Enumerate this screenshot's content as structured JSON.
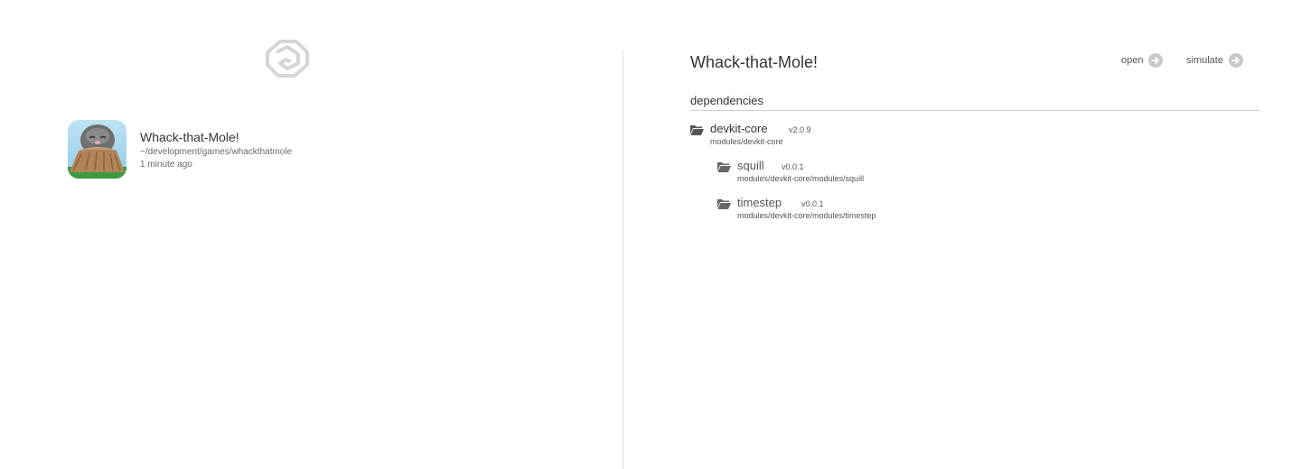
{
  "sidebar": {
    "logo_icon": "devkit-logo-icon",
    "projects": [
      {
        "name": "Whack-that-Mole!",
        "path": "~/development/games/whackthatmole",
        "modified": "1 minute ago",
        "icon": "mole-app-icon"
      }
    ]
  },
  "detail": {
    "title": "Whack-that-Mole!",
    "actions": {
      "open_label": "open",
      "simulate_label": "simulate",
      "icon": "arrow-right-circle-icon"
    },
    "dependencies_label": "dependencies",
    "dependencies": [
      {
        "name": "devkit-core",
        "version": "v2.0.9",
        "path": "modules/devkit-core"
      },
      {
        "name": "squill",
        "version": "v0.0.1",
        "path": "modules/devkit-core/modules/squill"
      },
      {
        "name": "timestep",
        "version": "v0.0.1",
        "path": "modules/devkit-core/modules/timestep"
      }
    ]
  },
  "colors": {
    "background": "#ffffff",
    "text": "#333333",
    "muted_text": "#6a6a6a",
    "divider": "#e4e4e4",
    "action_icon": "#c8c8c8"
  }
}
